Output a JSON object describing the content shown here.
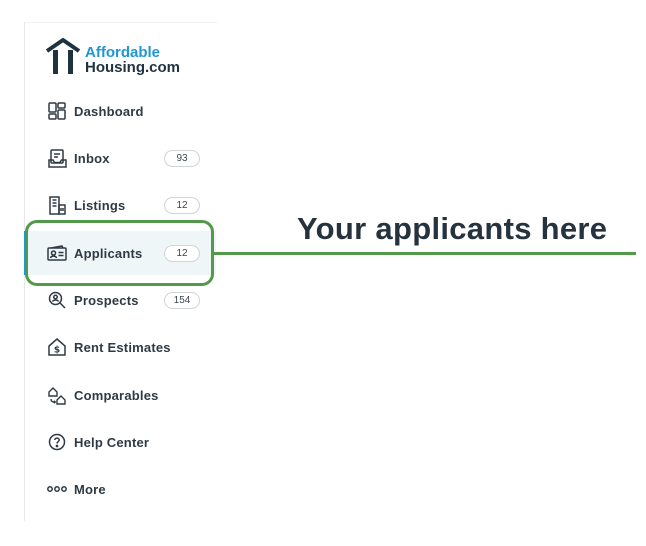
{
  "logo": {
    "line1": "Affordable",
    "line2": "Housing.com"
  },
  "nav": [
    {
      "label": "Dashboard",
      "icon": "dashboard-icon"
    },
    {
      "label": "Inbox",
      "icon": "inbox-icon",
      "badge": "93"
    },
    {
      "label": "Listings",
      "icon": "listings-icon",
      "badge": "12"
    },
    {
      "label": "Applicants",
      "icon": "applicants-icon",
      "badge": "12",
      "active": true
    },
    {
      "label": "Prospects",
      "icon": "prospects-icon",
      "badge": "154"
    },
    {
      "label": "Rent Estimates",
      "icon": "rent-estimates-icon"
    },
    {
      "label": "Comparables",
      "icon": "comparables-icon"
    },
    {
      "label": "Help Center",
      "icon": "help-center-icon"
    },
    {
      "label": "More",
      "icon": "more-icon"
    }
  ],
  "callout": {
    "text": "Your applicants here"
  },
  "colors": {
    "brand_blue": "#1f97d4",
    "brand_dark": "#1e3240",
    "highlight_green": "#529a4a",
    "active_bg": "#eef6f8"
  }
}
